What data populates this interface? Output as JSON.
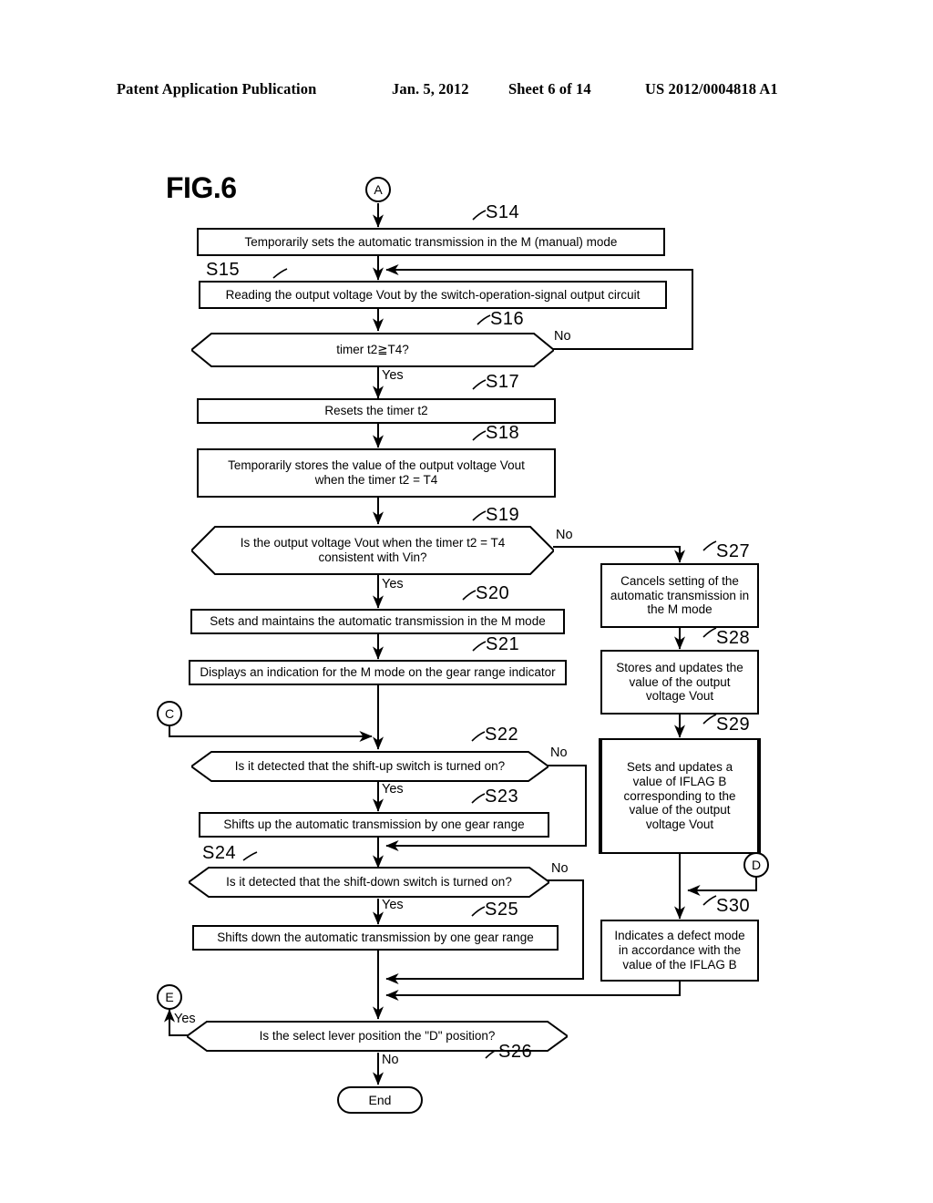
{
  "header": {
    "publication": "Patent Application Publication",
    "date": "Jan. 5, 2012",
    "sheet": "Sheet 6 of 14",
    "number": "US 2012/0004818 A1"
  },
  "figure": {
    "label": "FIG.6"
  },
  "connectors": {
    "a": "A",
    "c": "C",
    "d": "D",
    "e": "E"
  },
  "terminator": {
    "end": "End"
  },
  "branch_labels": {
    "yes": "Yes",
    "no": "No"
  },
  "steps": [
    {
      "id": "S14",
      "tag": "S14",
      "shape": "process",
      "text": "Temporarily sets the automatic transmission in the M (manual) mode"
    },
    {
      "id": "S15",
      "tag": "S15",
      "shape": "process",
      "text": "Reading the output voltage Vout by the switch-operation-signal output circuit"
    },
    {
      "id": "S16",
      "tag": "S16",
      "shape": "decision",
      "text": "timer t2≧T4?",
      "yes": "Yes",
      "no": "No"
    },
    {
      "id": "S17",
      "tag": "S17",
      "shape": "process",
      "text": "Resets the timer t2"
    },
    {
      "id": "S18",
      "tag": "S18",
      "shape": "process",
      "line1": "Temporarily stores the value of the output voltage Vout",
      "line2": "when the timer t2 = T4"
    },
    {
      "id": "S19",
      "tag": "S19",
      "shape": "decision",
      "line1": "Is the output voltage Vout when the timer t2 = T4",
      "line2": "consistent with Vin?",
      "yes": "Yes",
      "no": "No"
    },
    {
      "id": "S20",
      "tag": "S20",
      "shape": "process",
      "text": "Sets and maintains the automatic transmission in the M mode"
    },
    {
      "id": "S21",
      "tag": "S21",
      "shape": "process",
      "text": "Displays an indication for the M mode on the gear range indicator"
    },
    {
      "id": "S22",
      "tag": "S22",
      "shape": "decision",
      "text": "Is it detected that the shift-up switch is turned on?",
      "yes": "Yes",
      "no": "No"
    },
    {
      "id": "S23",
      "tag": "S23",
      "shape": "process",
      "text": "Shifts up the automatic transmission by one gear range"
    },
    {
      "id": "S24",
      "tag": "S24",
      "shape": "decision",
      "text": "Is it detected that the shift-down switch is turned on?",
      "yes": "Yes",
      "no": "No"
    },
    {
      "id": "S25",
      "tag": "S25",
      "shape": "process",
      "text": "Shifts down the automatic transmission by one gear range"
    },
    {
      "id": "S26",
      "tag": "S26",
      "shape": "decision",
      "text": "Is the select lever position the \"D\" position?",
      "yes": "Yes",
      "no": "No"
    },
    {
      "id": "S27",
      "tag": "S27",
      "shape": "process",
      "line1": "Cancels setting of the",
      "line2": "automatic transmission in",
      "line3": "the M mode"
    },
    {
      "id": "S28",
      "tag": "S28",
      "shape": "process",
      "line1": "Stores and updates the",
      "line2": "value of the output",
      "line3": "voltage Vout"
    },
    {
      "id": "S29",
      "tag": "S29",
      "shape": "process-double",
      "line1": "Sets and updates a",
      "line2": "value of IFLAG B",
      "line3": "corresponding to the",
      "line4": "value of the output",
      "line5": "voltage Vout"
    },
    {
      "id": "S30",
      "tag": "S30",
      "shape": "process",
      "line1": "Indicates a defect mode",
      "line2": "in accordance with the",
      "line3": "value of the IFLAG B"
    }
  ],
  "colors": {
    "ink": "#000000",
    "paper": "#ffffff"
  }
}
